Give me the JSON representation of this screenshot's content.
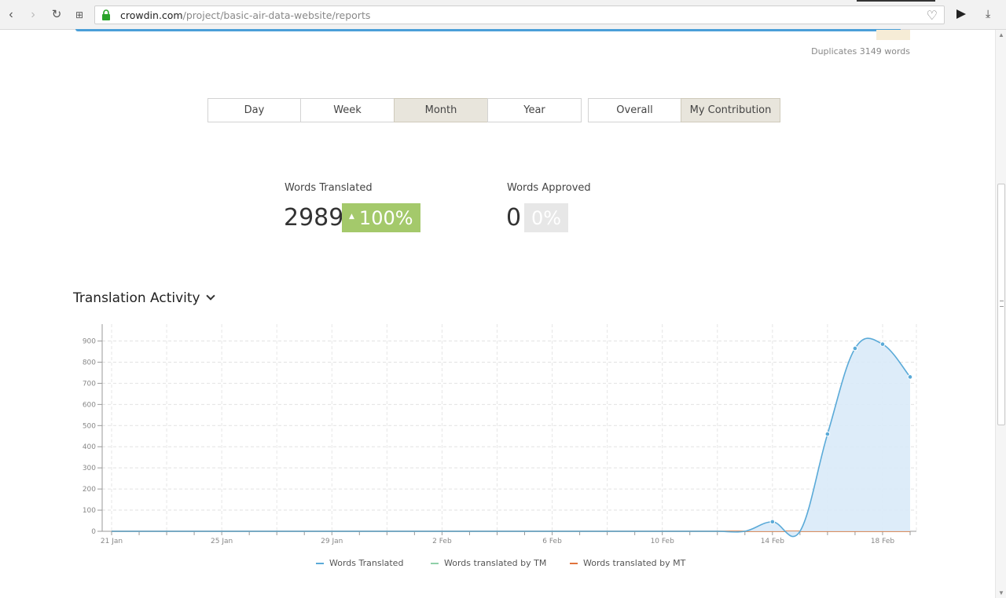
{
  "browser": {
    "url_host": "crowdin.com",
    "url_path": "/project/basic-air-data-website/reports"
  },
  "summary": {
    "duplicates": "Duplicates 3149 words"
  },
  "period_buttons": [
    {
      "label": "Day",
      "active": false
    },
    {
      "label": "Week",
      "active": false
    },
    {
      "label": "Month",
      "active": true
    },
    {
      "label": "Year",
      "active": false
    }
  ],
  "scope_buttons": [
    {
      "label": "Overall",
      "active": false
    },
    {
      "label": "My Contribution",
      "active": true
    }
  ],
  "stats": {
    "translated_label": "Words Translated",
    "translated_value": "2989",
    "translated_change": "100%",
    "approved_label": "Words Approved",
    "approved_value": "0",
    "approved_change": "0%"
  },
  "section": {
    "title": "Translation Activity"
  },
  "colors": {
    "translated": "#5aaad8",
    "tm": "#8fcfa8",
    "mt": "#e0733c",
    "area_fill": "#d9eaf8",
    "green_badge": "#a4c96b"
  },
  "chart_data": {
    "type": "area",
    "x": [
      "21 Jan",
      "22 Jan",
      "23 Jan",
      "24 Jan",
      "25 Jan",
      "26 Jan",
      "27 Jan",
      "28 Jan",
      "29 Jan",
      "30 Jan",
      "31 Jan",
      "1 Feb",
      "2 Feb",
      "3 Feb",
      "4 Feb",
      "5 Feb",
      "6 Feb",
      "7 Feb",
      "8 Feb",
      "9 Feb",
      "10 Feb",
      "11 Feb",
      "12 Feb",
      "13 Feb",
      "14 Feb",
      "15 Feb",
      "16 Feb",
      "17 Feb",
      "18 Feb",
      "19 Feb"
    ],
    "x_tick_labels": [
      "21 Jan",
      "25 Jan",
      "29 Jan",
      "2 Feb",
      "6 Feb",
      "10 Feb",
      "14 Feb",
      "18 Feb"
    ],
    "y_ticks": [
      0,
      100,
      200,
      300,
      400,
      500,
      600,
      700,
      800,
      900
    ],
    "ylim": [
      0,
      980
    ],
    "grid": true,
    "legend_position": "bottom",
    "series": [
      {
        "name": "Words Translated",
        "values": [
          0,
          0,
          0,
          0,
          0,
          0,
          0,
          0,
          0,
          0,
          0,
          0,
          0,
          0,
          0,
          0,
          0,
          0,
          0,
          0,
          0,
          0,
          0,
          0,
          45,
          0,
          460,
          865,
          885,
          730
        ]
      },
      {
        "name": "Words translated by TM",
        "values": [
          0,
          0,
          0,
          0,
          0,
          0,
          0,
          0,
          0,
          0,
          0,
          0,
          0,
          0,
          0,
          0,
          0,
          0,
          0,
          0,
          0,
          0,
          0,
          0,
          0,
          0,
          0,
          0,
          0,
          0
        ]
      },
      {
        "name": "Words translated by MT",
        "values": [
          0,
          0,
          0,
          0,
          0,
          0,
          0,
          0,
          0,
          0,
          0,
          0,
          0,
          0,
          0,
          0,
          0,
          0,
          0,
          0,
          0,
          0,
          0,
          0,
          0,
          0,
          0,
          0,
          0,
          0
        ]
      }
    ]
  }
}
